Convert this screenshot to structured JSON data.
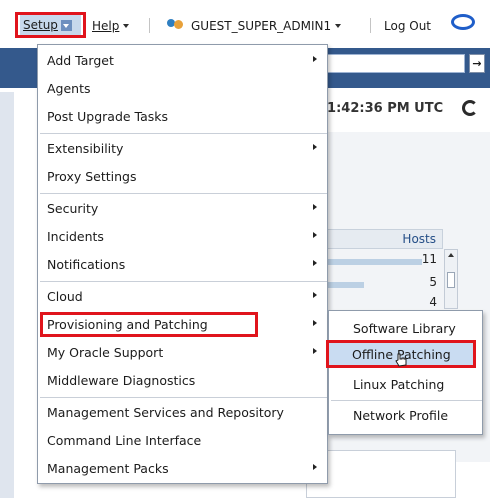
{
  "topbar": {
    "setup_label": "Setup",
    "help_label": "Help",
    "user_label": "GUEST_SUPER_ADMIN1",
    "logout_label": "Log Out"
  },
  "background": {
    "time_text": "11:42:36 PM UTC",
    "hosts_header": "Hosts",
    "hosts_values": [
      "11",
      "5",
      "4"
    ],
    "go_arrow": "→"
  },
  "setup_menu": {
    "items": [
      {
        "label": "Add Target",
        "has_submenu": true
      },
      {
        "label": "Agents",
        "has_submenu": false
      },
      {
        "label": "Post Upgrade Tasks",
        "has_submenu": false
      },
      {
        "label": "Extensibility",
        "has_submenu": true
      },
      {
        "label": "Proxy Settings",
        "has_submenu": false
      },
      {
        "label": "Security",
        "has_submenu": true
      },
      {
        "label": "Incidents",
        "has_submenu": true
      },
      {
        "label": "Notifications",
        "has_submenu": true
      },
      {
        "label": "Cloud",
        "has_submenu": true
      },
      {
        "label": "Provisioning and Patching",
        "has_submenu": true
      },
      {
        "label": "My Oracle Support",
        "has_submenu": true
      },
      {
        "label": "Middleware Diagnostics",
        "has_submenu": false
      },
      {
        "label": "Management Services and Repository",
        "has_submenu": false
      },
      {
        "label": "Command Line Interface",
        "has_submenu": false
      },
      {
        "label": "Management Packs",
        "has_submenu": true
      }
    ]
  },
  "provisioning_submenu": {
    "items": [
      {
        "label": "Software Library"
      },
      {
        "label": "Offline Patching"
      },
      {
        "label": "Linux Patching"
      },
      {
        "label": "Network Profile"
      }
    ]
  },
  "colors": {
    "highlight_border": "#e0141c",
    "blue_bar": "#34598c",
    "hover_fill": "#c9dcf2"
  }
}
